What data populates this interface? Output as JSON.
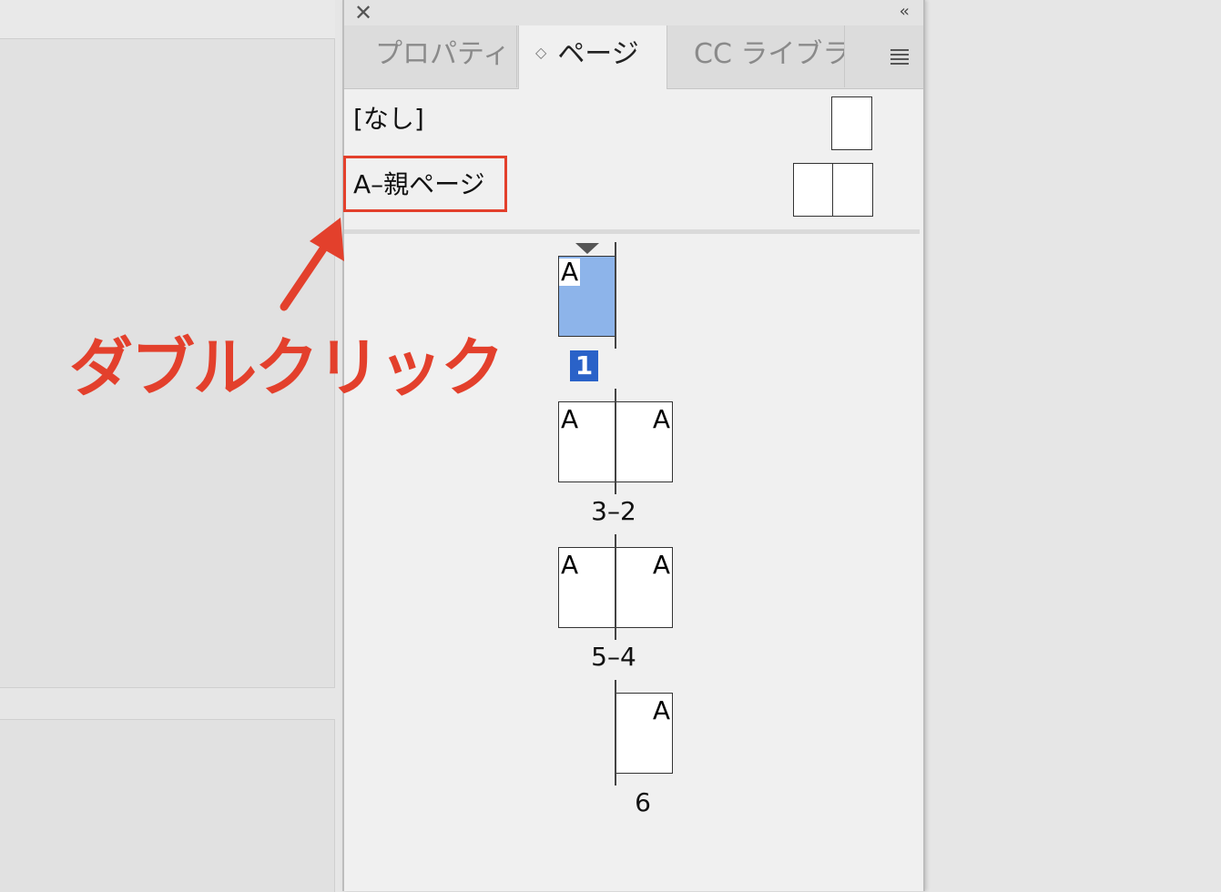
{
  "panel": {
    "tabs": [
      {
        "label": "プロパティ"
      },
      {
        "label": "ページ"
      },
      {
        "label": "CC ライブラ"
      }
    ],
    "parents": [
      {
        "label": "[なし]"
      },
      {
        "label": "A–親ページ"
      }
    ],
    "pages": {
      "page1": {
        "letter": "A",
        "number": "1"
      },
      "spread_3_2": {
        "left_letter": "A",
        "right_letter": "A",
        "number": "3–2"
      },
      "spread_5_4": {
        "left_letter": "A",
        "right_letter": "A",
        "number": "5–4"
      },
      "page6": {
        "letter": "A",
        "number": "6"
      }
    }
  },
  "annotation": {
    "text": "ダブルクリック",
    "color": "#e3402c"
  },
  "colors": {
    "selected_page": "#8db4ea",
    "selected_number": "#2a62c8",
    "highlight": "#e3402c"
  }
}
